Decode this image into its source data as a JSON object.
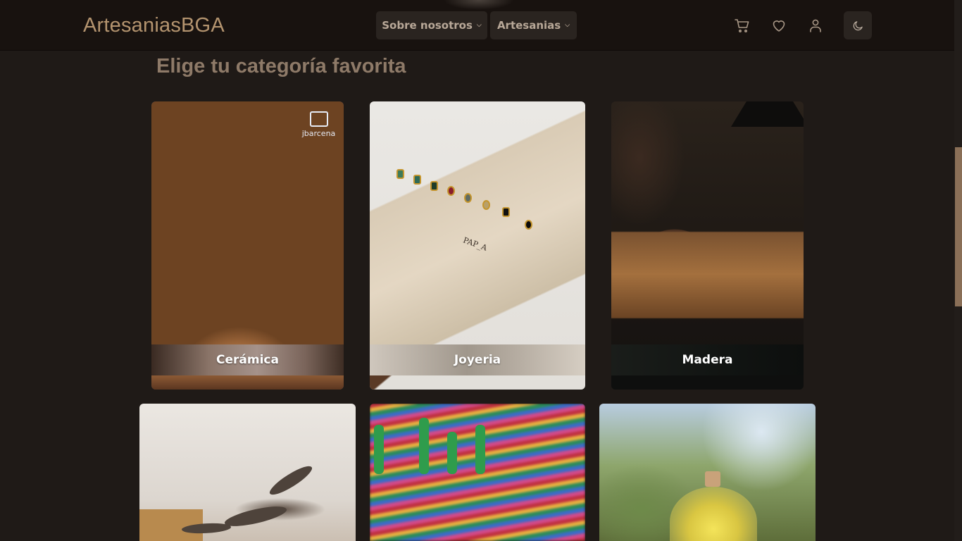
{
  "header": {
    "brand": "ArtesaniasBGA",
    "nav": [
      {
        "label": "Sobre nosotros"
      },
      {
        "label": "Artesanias"
      }
    ],
    "icons": [
      "cart-icon",
      "heart-icon",
      "user-icon",
      "moon-icon"
    ]
  },
  "main": {
    "section_title": "Elige tu categoría favorita",
    "categories": [
      {
        "label": "Cerámica",
        "watermark": "jbarcena"
      },
      {
        "label": "Joyeria",
        "stamp": "PAP_A"
      },
      {
        "label": "Madera"
      },
      {
        "label": ""
      },
      {
        "label": ""
      },
      {
        "label": ""
      }
    ]
  },
  "colors": {
    "header_bg": "#18120f",
    "page_bg": "#1f1a17",
    "brand_text": "#b4946f",
    "title_text": "#8e7a68",
    "nav_button_bg": "#2a2420",
    "scroll_thumb": "#8a6f57"
  }
}
